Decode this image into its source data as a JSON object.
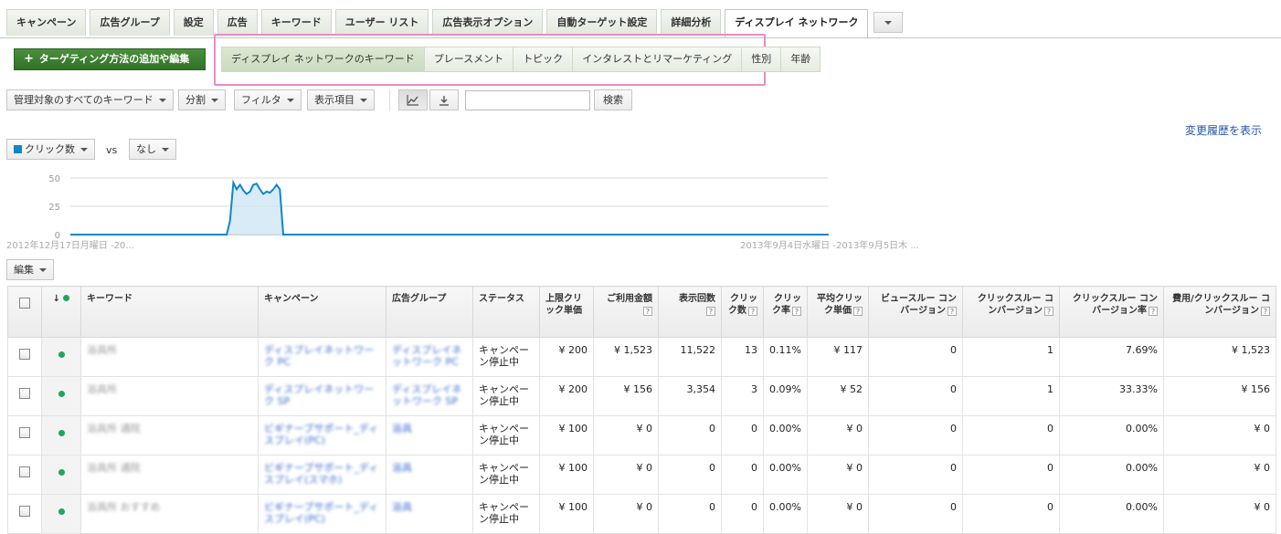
{
  "tabs": [
    {
      "label": "キャンペーン",
      "active": false
    },
    {
      "label": "広告グループ",
      "active": false
    },
    {
      "label": "設定",
      "active": false
    },
    {
      "label": "広告",
      "active": false
    },
    {
      "label": "キーワード",
      "active": false
    },
    {
      "label": "ユーザー リスト",
      "active": false
    },
    {
      "label": "広告表示オプション",
      "active": false
    },
    {
      "label": "自動ターゲット設定",
      "active": false
    },
    {
      "label": "詳細分析",
      "active": false
    },
    {
      "label": "ディスプレイ ネットワーク",
      "active": true
    }
  ],
  "targeting": {
    "add_button_plus": "+",
    "add_button_label": "ターゲティング方法の追加や編集",
    "subtabs": [
      {
        "label": "ディスプレイ ネットワークのキーワード",
        "active": true
      },
      {
        "label": "プレースメント",
        "active": false
      },
      {
        "label": "トピック",
        "active": false
      },
      {
        "label": "インタレストとリマーケティング",
        "active": false
      },
      {
        "label": "性別",
        "active": false
      },
      {
        "label": "年齢",
        "active": false
      }
    ]
  },
  "toolbar": {
    "scope_label": "管理対象のすべてのキーワード",
    "segment_label": "分割",
    "filter_label": "フィルタ",
    "columns_label": "表示項目",
    "search_value": "",
    "search_button": "検索",
    "chart_icon": "line-chart-icon",
    "download_icon": "download-icon",
    "history_link": "変更履歴を表示"
  },
  "chart_controls": {
    "metric1": "クリック数",
    "vs": "vs",
    "metric2": "なし",
    "series_color": "#1186c6"
  },
  "chart_data": {
    "type": "area",
    "series": [
      {
        "name": "クリック数",
        "values": [
          0,
          0,
          0,
          0,
          0,
          0,
          0,
          0,
          0,
          0,
          0,
          0,
          0,
          0,
          0,
          0,
          0,
          0,
          0,
          0,
          0,
          0,
          0,
          0,
          0,
          0,
          0,
          0,
          0,
          0,
          0,
          0,
          0,
          0,
          0,
          0,
          0,
          0,
          0,
          0,
          0,
          0,
          0,
          0,
          0,
          0,
          0,
          0,
          12,
          46,
          40,
          44,
          39,
          36,
          38,
          44,
          45,
          40,
          36,
          38,
          37,
          40,
          44,
          40,
          0,
          0,
          0,
          0,
          0,
          0,
          0,
          0,
          0,
          0,
          0,
          0,
          0,
          0,
          0,
          0,
          0,
          0,
          0,
          0,
          0,
          0,
          0,
          0,
          0,
          0,
          0,
          0,
          0,
          0,
          0,
          0,
          0,
          0,
          0,
          0,
          0,
          0,
          0,
          0,
          0,
          0,
          0,
          0,
          0,
          0,
          0,
          0,
          0,
          0,
          0,
          0,
          0,
          0,
          0,
          0,
          0,
          0,
          0,
          0,
          0,
          0,
          0,
          0,
          0,
          0,
          0,
          0,
          0,
          0,
          0,
          0,
          0,
          0,
          0,
          0,
          0,
          0,
          0,
          0,
          0,
          0,
          0,
          0,
          0,
          0,
          0,
          0,
          0,
          0,
          0,
          0,
          0,
          0,
          0,
          0,
          0,
          0,
          0,
          0,
          0,
          0,
          0,
          0,
          0,
          0,
          0,
          0,
          0,
          0,
          0,
          0,
          0,
          0,
          0,
          0,
          0,
          0,
          0,
          0,
          0,
          0,
          0,
          0,
          0,
          0,
          0,
          0,
          0,
          0,
          0,
          0,
          0,
          0,
          0,
          0,
          0,
          0,
          0,
          0,
          0,
          0,
          0,
          0,
          0,
          0,
          0,
          0,
          0,
          0,
          0,
          0,
          0,
          0,
          0,
          0,
          0,
          0,
          0,
          0,
          0,
          0,
          0,
          0,
          0
        ]
      }
    ],
    "y_ticks": [
      "50",
      "25",
      "0"
    ],
    "ylim": [
      0,
      50
    ],
    "x_start_label": "2012年12月17日月曜日 -20...",
    "x_end_label": "2013年9月4日水曜日 -2013年9月5日木 ...",
    "grid": true
  },
  "table": {
    "edit_label": "編集",
    "sort_arrow": "↓",
    "help_mark": "?",
    "columns": [
      {
        "key": "check",
        "label": ""
      },
      {
        "key": "status_dot",
        "label": ""
      },
      {
        "key": "keyword",
        "label": "キーワード"
      },
      {
        "key": "campaign",
        "label": "キャンペーン"
      },
      {
        "key": "adgroup",
        "label": "広告グループ"
      },
      {
        "key": "status",
        "label": "ステータス"
      },
      {
        "key": "max_cpc",
        "label": "上限クリック単価"
      },
      {
        "key": "cost",
        "label": "ご利用金額"
      },
      {
        "key": "impressions",
        "label": "表示回数"
      },
      {
        "key": "clicks",
        "label": "クリック数"
      },
      {
        "key": "ctr",
        "label": "クリック率"
      },
      {
        "key": "avg_cpc",
        "label": "平均クリック単価"
      },
      {
        "key": "view_through_conv",
        "label": "ビュースルー コンバージョン"
      },
      {
        "key": "click_through_conv",
        "label": "クリックスルー コンバージョン"
      },
      {
        "key": "click_through_conv_rate",
        "label": "クリックスルー コンバージョン率"
      },
      {
        "key": "cost_per_conv",
        "label": "費用/クリックスルー コンバージョン"
      }
    ],
    "rows": [
      {
        "keyword": "浴具所",
        "campaign": "ディスプレイネットワーク PC",
        "adgroup": "ディスプレイネットワーク PC",
        "status": "キャンペーン停止中",
        "max_cpc": "¥ 200",
        "cost": "¥ 1,523",
        "impressions": "11,522",
        "clicks": "13",
        "ctr": "0.11%",
        "avg_cpc": "¥ 117",
        "view_through_conv": "0",
        "click_through_conv": "1",
        "click_through_conv_rate": "7.69%",
        "cost_per_conv": "¥ 1,523"
      },
      {
        "keyword": "浴具所",
        "campaign": "ディスプレイネットワーク SP",
        "adgroup": "ディスプレイネットワーク SP",
        "status": "キャンペーン停止中",
        "max_cpc": "¥ 200",
        "cost": "¥ 156",
        "impressions": "3,354",
        "clicks": "3",
        "ctr": "0.09%",
        "avg_cpc": "¥ 52",
        "view_through_conv": "0",
        "click_through_conv": "1",
        "click_through_conv_rate": "33.33%",
        "cost_per_conv": "¥ 156"
      },
      {
        "keyword": "浴具所 通院",
        "campaign": "ビギナーブサポート_ディスプレイ(PC)",
        "adgroup": "浴具",
        "status": "キャンペーン停止中",
        "max_cpc": "¥ 100",
        "cost": "¥ 0",
        "impressions": "0",
        "clicks": "0",
        "ctr": "0.00%",
        "avg_cpc": "¥ 0",
        "view_through_conv": "0",
        "click_through_conv": "0",
        "click_through_conv_rate": "0.00%",
        "cost_per_conv": "¥ 0"
      },
      {
        "keyword": "浴具所 通院",
        "campaign": "ビギナーブサポート_ディスプレイ(スマホ)",
        "adgroup": "浴具",
        "status": "キャンペーン停止中",
        "max_cpc": "¥ 100",
        "cost": "¥ 0",
        "impressions": "0",
        "clicks": "0",
        "ctr": "0.00%",
        "avg_cpc": "¥ 0",
        "view_through_conv": "0",
        "click_through_conv": "0",
        "click_through_conv_rate": "0.00%",
        "cost_per_conv": "¥ 0"
      },
      {
        "keyword": "浴具所 おすすめ",
        "campaign": "ビギナーブサポート_ディスプレイ(PC)",
        "adgroup": "浴具",
        "status": "キャンペーン停止中",
        "max_cpc": "¥ 100",
        "cost": "¥ 0",
        "impressions": "0",
        "clicks": "0",
        "ctr": "0.00%",
        "avg_cpc": "¥ 0",
        "view_through_conv": "0",
        "click_through_conv": "0",
        "click_through_conv_rate": "0.00%",
        "cost_per_conv": "¥ 0"
      }
    ]
  }
}
